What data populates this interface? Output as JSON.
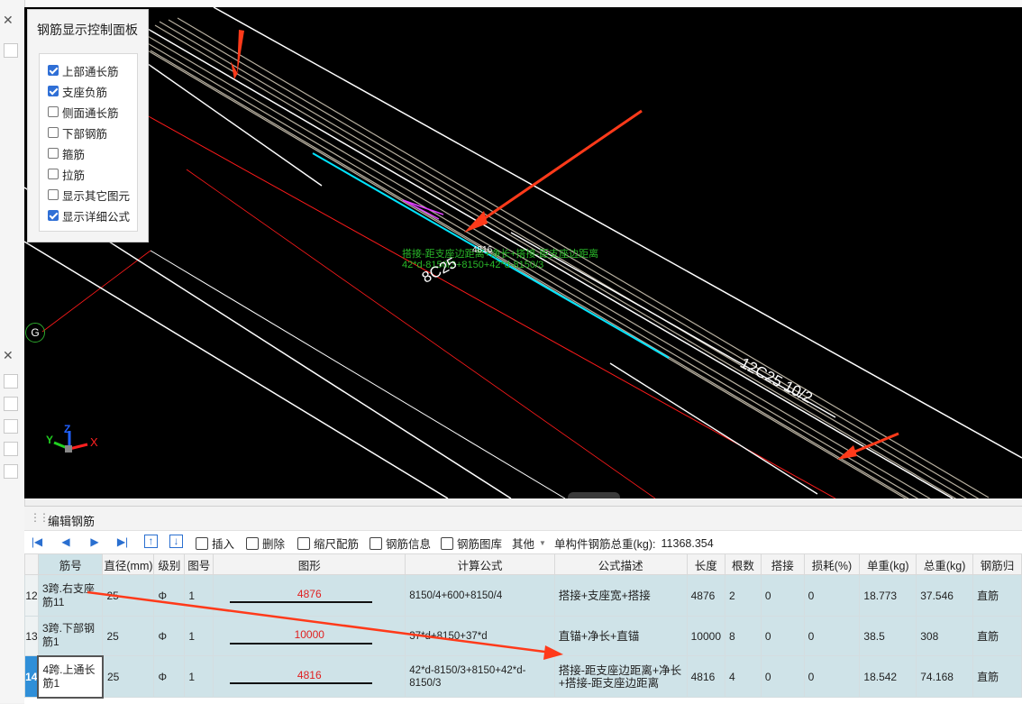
{
  "panel": {
    "title": "钢筋显示控制面板",
    "options": [
      {
        "label": "上部通长筋",
        "checked": true
      },
      {
        "label": "支座负筋",
        "checked": true
      },
      {
        "label": "侧面通长筋",
        "checked": false
      },
      {
        "label": "下部钢筋",
        "checked": false
      },
      {
        "label": "箍筋",
        "checked": false
      },
      {
        "label": "拉筋",
        "checked": false
      },
      {
        "label": "显示其它图元",
        "checked": false
      },
      {
        "label": "显示详细公式",
        "checked": true
      }
    ]
  },
  "viewport": {
    "annot_line1": "搭接-距支座边距离+净长+搭接-距支座边距离",
    "annot_line2": "42*d-8150/3+8150+42*d-8150/3",
    "length_label": "4816",
    "label_8c25": "8C25",
    "label_12c25": "12C25 10/2",
    "axis_marker": "G",
    "axis_x": "X",
    "axis_y": "Y",
    "axis_z": "Z",
    "collapse_symbol": "⌄",
    "colors": {
      "cyan": "#00e5ff",
      "red": "#ff0000",
      "arrow": "#ff3a1a",
      "green_text": "#29b829",
      "magenta": "#e040ff"
    }
  },
  "editor": {
    "title": "编辑钢筋",
    "toolbar": {
      "insert": "插入",
      "delete": "删除",
      "scale": "缩尺配筋",
      "info": "钢筋信息",
      "library": "钢筋图库",
      "other": "其他",
      "total_label": "单构件钢筋总重(kg):",
      "total_value": "11368.354"
    },
    "columns": [
      "筋号",
      "直径(mm)",
      "级别",
      "图号",
      "图形",
      "计算公式",
      "公式描述",
      "长度",
      "根数",
      "搭接",
      "损耗(%)",
      "单重(kg)",
      "总重(kg)",
      "钢筋归"
    ],
    "rows": [
      {
        "no": "12",
        "name": "3跨.右支座筋11",
        "dia": "25",
        "grade": "Φ",
        "fig": "1",
        "shape": "4876",
        "formula": "8150/4+600+8150/4",
        "desc": "搭接+支座宽+搭接",
        "len": "4876",
        "count": "2",
        "lap": "0",
        "loss": "0",
        "unit": "18.773",
        "total": "37.546",
        "type": "直筋"
      },
      {
        "no": "13",
        "name": "3跨.下部钢筋1",
        "dia": "25",
        "grade": "Φ",
        "fig": "1",
        "shape": "10000",
        "formula": "37*d+8150+37*d",
        "desc": "直锚+净长+直锚",
        "len": "10000",
        "count": "8",
        "lap": "0",
        "loss": "0",
        "unit": "38.5",
        "total": "308",
        "type": "直筋"
      },
      {
        "no": "14",
        "name": "4跨.上通长筋1",
        "dia": "25",
        "grade": "Φ",
        "fig": "1",
        "shape": "4816",
        "formula": "42*d-8150/3+8150+42*d-8150/3",
        "desc": "搭接-距支座边距离+净长+搭接-距支座边距离",
        "len": "4816",
        "count": "4",
        "lap": "0",
        "loss": "0",
        "unit": "18.542",
        "total": "74.168",
        "type": "直筋"
      }
    ]
  }
}
